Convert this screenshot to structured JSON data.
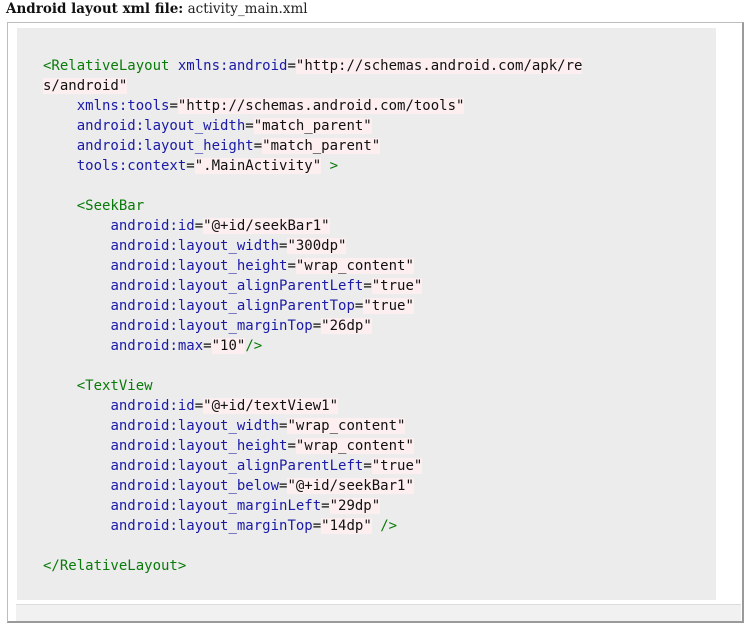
{
  "caption": {
    "label": "Android layout xml file:",
    "filename": "activity_main.xml"
  },
  "code_lines": [
    [
      {
        "cls": "tag",
        "text": "<RelativeLayout"
      },
      {
        "cls": "plain",
        "text": " "
      },
      {
        "cls": "attr",
        "text": "xmlns:android"
      },
      {
        "cls": "plain",
        "text": "="
      },
      {
        "cls": "val",
        "text": "\"http://schemas.android.com/apk/re"
      }
    ],
    [
      {
        "cls": "val",
        "text": "s/android\""
      }
    ],
    [
      {
        "cls": "plain",
        "text": "    "
      },
      {
        "cls": "attr",
        "text": "xmlns:tools"
      },
      {
        "cls": "plain",
        "text": "="
      },
      {
        "cls": "val",
        "text": "\"http://schemas.android.com/tools\""
      }
    ],
    [
      {
        "cls": "plain",
        "text": "    "
      },
      {
        "cls": "attr",
        "text": "android:layout_width"
      },
      {
        "cls": "plain",
        "text": "="
      },
      {
        "cls": "val",
        "text": "\"match_parent\""
      }
    ],
    [
      {
        "cls": "plain",
        "text": "    "
      },
      {
        "cls": "attr",
        "text": "android:layout_height"
      },
      {
        "cls": "plain",
        "text": "="
      },
      {
        "cls": "val",
        "text": "\"match_parent\""
      }
    ],
    [
      {
        "cls": "plain",
        "text": "    "
      },
      {
        "cls": "attr",
        "text": "tools:context"
      },
      {
        "cls": "plain",
        "text": "="
      },
      {
        "cls": "val",
        "text": "\".MainActivity\""
      },
      {
        "cls": "plain",
        "text": " "
      },
      {
        "cls": "tag",
        "text": ">"
      }
    ],
    [],
    [
      {
        "cls": "plain",
        "text": "    "
      },
      {
        "cls": "tag",
        "text": "<SeekBar"
      }
    ],
    [
      {
        "cls": "plain",
        "text": "        "
      },
      {
        "cls": "attr",
        "text": "android:id"
      },
      {
        "cls": "plain",
        "text": "="
      },
      {
        "cls": "val",
        "text": "\"@+id/seekBar1\""
      }
    ],
    [
      {
        "cls": "plain",
        "text": "        "
      },
      {
        "cls": "attr",
        "text": "android:layout_width"
      },
      {
        "cls": "plain",
        "text": "="
      },
      {
        "cls": "val",
        "text": "\"300dp\""
      }
    ],
    [
      {
        "cls": "plain",
        "text": "        "
      },
      {
        "cls": "attr",
        "text": "android:layout_height"
      },
      {
        "cls": "plain",
        "text": "="
      },
      {
        "cls": "val",
        "text": "\"wrap_content\""
      }
    ],
    [
      {
        "cls": "plain",
        "text": "        "
      },
      {
        "cls": "attr",
        "text": "android:layout_alignParentLeft"
      },
      {
        "cls": "plain",
        "text": "="
      },
      {
        "cls": "val",
        "text": "\"true\""
      }
    ],
    [
      {
        "cls": "plain",
        "text": "        "
      },
      {
        "cls": "attr",
        "text": "android:layout_alignParentTop"
      },
      {
        "cls": "plain",
        "text": "="
      },
      {
        "cls": "val",
        "text": "\"true\""
      }
    ],
    [
      {
        "cls": "plain",
        "text": "        "
      },
      {
        "cls": "attr",
        "text": "android:layout_marginTop"
      },
      {
        "cls": "plain",
        "text": "="
      },
      {
        "cls": "val",
        "text": "\"26dp\""
      }
    ],
    [
      {
        "cls": "plain",
        "text": "        "
      },
      {
        "cls": "attr",
        "text": "android:max"
      },
      {
        "cls": "plain",
        "text": "="
      },
      {
        "cls": "val",
        "text": "\"10\""
      },
      {
        "cls": "tag",
        "text": "/>"
      }
    ],
    [],
    [
      {
        "cls": "plain",
        "text": "    "
      },
      {
        "cls": "tag",
        "text": "<TextView"
      }
    ],
    [
      {
        "cls": "plain",
        "text": "        "
      },
      {
        "cls": "attr",
        "text": "android:id"
      },
      {
        "cls": "plain",
        "text": "="
      },
      {
        "cls": "val",
        "text": "\"@+id/textView1\""
      }
    ],
    [
      {
        "cls": "plain",
        "text": "        "
      },
      {
        "cls": "attr",
        "text": "android:layout_width"
      },
      {
        "cls": "plain",
        "text": "="
      },
      {
        "cls": "val",
        "text": "\"wrap_content\""
      }
    ],
    [
      {
        "cls": "plain",
        "text": "        "
      },
      {
        "cls": "attr",
        "text": "android:layout_height"
      },
      {
        "cls": "plain",
        "text": "="
      },
      {
        "cls": "val",
        "text": "\"wrap_content\""
      }
    ],
    [
      {
        "cls": "plain",
        "text": "        "
      },
      {
        "cls": "attr",
        "text": "android:layout_alignParentLeft"
      },
      {
        "cls": "plain",
        "text": "="
      },
      {
        "cls": "val",
        "text": "\"true\""
      }
    ],
    [
      {
        "cls": "plain",
        "text": "        "
      },
      {
        "cls": "attr",
        "text": "android:layout_below"
      },
      {
        "cls": "plain",
        "text": "="
      },
      {
        "cls": "val",
        "text": "\"@+id/seekBar1\""
      }
    ],
    [
      {
        "cls": "plain",
        "text": "        "
      },
      {
        "cls": "attr",
        "text": "android:layout_marginLeft"
      },
      {
        "cls": "plain",
        "text": "="
      },
      {
        "cls": "val",
        "text": "\"29dp\""
      }
    ],
    [
      {
        "cls": "plain",
        "text": "        "
      },
      {
        "cls": "attr",
        "text": "android:layout_marginTop"
      },
      {
        "cls": "plain",
        "text": "="
      },
      {
        "cls": "val",
        "text": "\"14dp\""
      },
      {
        "cls": "plain",
        "text": " "
      },
      {
        "cls": "tag",
        "text": "/>"
      }
    ],
    [],
    [
      {
        "cls": "tag",
        "text": "</RelativeLayout>"
      }
    ]
  ],
  "colors": {
    "tag": "#0a7a0a",
    "attribute": "#1a1aa6",
    "value_background": "#fdeff0",
    "code_background": "#ececec"
  }
}
